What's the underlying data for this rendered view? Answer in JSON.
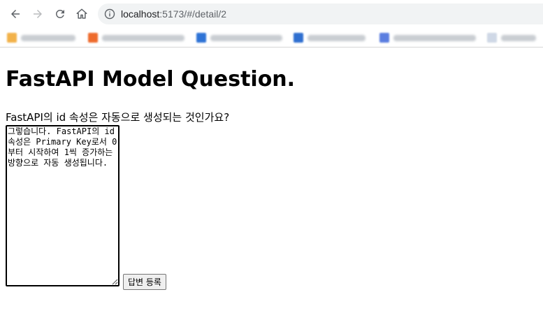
{
  "browser": {
    "url_host": "localhost",
    "url_path": ":5173/#/detail/2",
    "icons": [
      "back-arrow-icon",
      "forward-arrow-icon",
      "reload-icon",
      "home-icon",
      "info-icon"
    ],
    "bookmark_favicon_colors": [
      "#f2b24a",
      "#ee6b2d",
      "#2f73d6",
      "#2f6fd0",
      "#5b7ee0",
      "#cfd8e6"
    ]
  },
  "page": {
    "title": "FastAPI Model Question.",
    "question": "FastAPI의 id 속성은 자동으로 생성되는 것인가요?",
    "answer_value": "그렇습니다. FastAPI의 id 속성은 Primary Key로서 0부터 시작하여 1씩 증가하는 방향으로 자동 생성됩니다.",
    "submit_label": "답변 등록"
  }
}
